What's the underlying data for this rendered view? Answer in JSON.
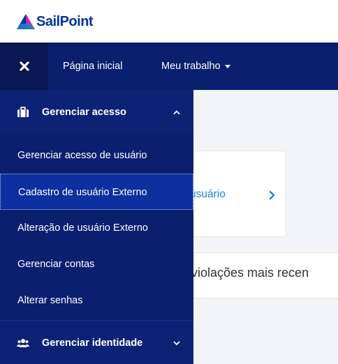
{
  "brand": {
    "name": "SailPoint",
    "color": "#0033a1",
    "accent": "#1a87c9"
  },
  "topnav": {
    "close_icon": "close-icon",
    "home_label": "Página inicial",
    "work_label": "Meu trabalho",
    "background": "#0a1f6e"
  },
  "sidemenu": {
    "sections": [
      {
        "label": "Gerenciar acesso",
        "icon": "briefcase-icon",
        "expanded": true
      },
      {
        "label": "Gerenciar identidade",
        "icon": "users-icon",
        "expanded": false
      }
    ],
    "items": [
      {
        "label": "Gerenciar acesso de usuário"
      },
      {
        "label": "Cadastro de usuário Externo",
        "active": true
      },
      {
        "label": "Alteração de usuário Externo"
      },
      {
        "label": "Gerenciar contas"
      },
      {
        "label": "Alterar senhas"
      }
    ]
  },
  "content": {
    "card_text": "usuário",
    "band_text": "violações mais recen"
  }
}
